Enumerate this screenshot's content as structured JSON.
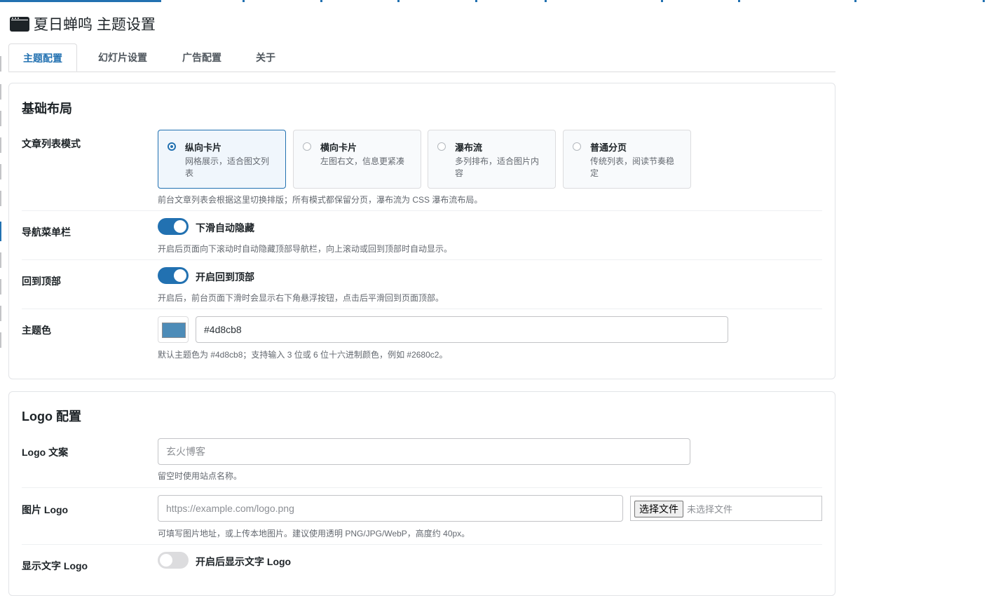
{
  "page": {
    "title": "夏日蝉鸣 主题设置",
    "window_icon": "window-icon"
  },
  "tabs": [
    {
      "label": "主题配置",
      "active": true
    },
    {
      "label": "幻灯片设置",
      "active": false
    },
    {
      "label": "广告配置",
      "active": false
    },
    {
      "label": "关于",
      "active": false
    }
  ],
  "layout_section": {
    "heading": "基础布局",
    "list_mode": {
      "label": "文章列表模式",
      "options": [
        {
          "title": "纵向卡片",
          "desc": "网格展示，适合图文列表",
          "selected": true
        },
        {
          "title": "横向卡片",
          "desc": "左图右文，信息更紧凑",
          "selected": false
        },
        {
          "title": "瀑布流",
          "desc": "多列排布，适合图片内容",
          "selected": false
        },
        {
          "title": "普通分页",
          "desc": "传统列表，阅读节奏稳定",
          "selected": false
        }
      ],
      "help": "前台文章列表会根据这里切换排版；所有模式都保留分页，瀑布流为 CSS 瀑布流布局。"
    },
    "nav_bar": {
      "label": "导航菜单栏",
      "toggle_label": "下滑自动隐藏",
      "on": true,
      "help": "开启后页面向下滚动时自动隐藏顶部导航栏，向上滚动或回到顶部时自动显示。"
    },
    "back_to_top": {
      "label": "回到顶部",
      "toggle_label": "开启回到顶部",
      "on": true,
      "help": "开启后，前台页面下滑时会显示右下角悬浮按钮，点击后平滑回到页面顶部。"
    },
    "theme_color": {
      "label": "主题色",
      "value": "#4d8cb8",
      "swatch_color": "#4d8cb8",
      "help": "默认主题色为 #4d8cb8；支持输入 3 位或 6 位十六进制颜色，例如 #2680c2。"
    }
  },
  "logo_section": {
    "heading": "Logo 配置",
    "logo_text": {
      "label": "Logo 文案",
      "placeholder": "玄火博客",
      "help": "留空时使用站点名称。"
    },
    "image_logo": {
      "label": "图片 Logo",
      "placeholder": "https://example.com/logo.png",
      "file_button": "选择文件",
      "file_status": "未选择文件",
      "help": "可填写图片地址，或上传本地图片。建议使用透明 PNG/JPG/WebP，高度约 40px。"
    },
    "show_text_logo": {
      "label": "显示文字 Logo",
      "toggle_label": "开启后显示文字 Logo",
      "on": false
    }
  },
  "colors": {
    "accent": "#2271b1",
    "toggle_off": "#dcdcde",
    "text": "#1d2327",
    "muted": "#646970"
  }
}
